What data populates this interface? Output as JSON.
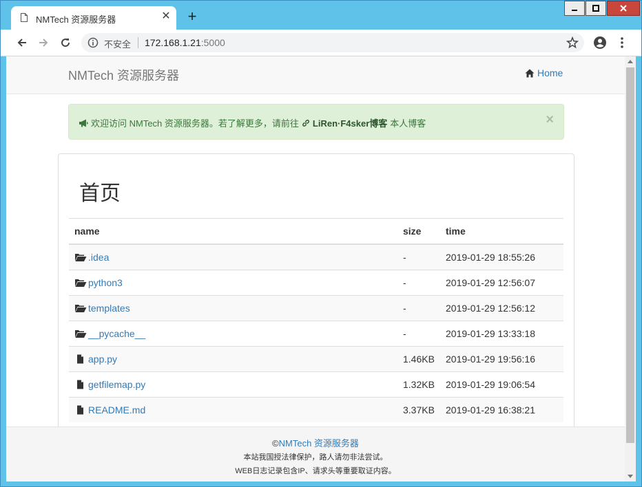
{
  "browser": {
    "tab_title": "NMTech 资源服务器",
    "security_label": "不安全",
    "url_host": "172.168.1.21",
    "url_port": ":5000"
  },
  "navbar": {
    "brand": "NMTech 资源服务器",
    "home_label": "Home"
  },
  "alert": {
    "text_before": "欢迎访问 NMTech 资源服务器。若了解更多，请前往",
    "link_text": "LiRen·F4sker博客",
    "text_after": "本人博客",
    "close": "×"
  },
  "page": {
    "title": "首页"
  },
  "table": {
    "headers": {
      "name": "name",
      "size": "size",
      "time": "time"
    },
    "rows": [
      {
        "icon": "folder-open-icon",
        "name": ".idea",
        "size": "-",
        "time": "2019-01-29 18:55:26"
      },
      {
        "icon": "folder-open-icon",
        "name": "python3",
        "size": "-",
        "time": "2019-01-29 12:56:07"
      },
      {
        "icon": "folder-open-icon",
        "name": "templates",
        "size": "-",
        "time": "2019-01-29 12:56:12"
      },
      {
        "icon": "folder-open-icon",
        "name": "__pycache__",
        "size": "-",
        "time": "2019-01-29 13:33:18"
      },
      {
        "icon": "file-icon",
        "name": "app.py",
        "size": "1.46KB",
        "time": "2019-01-29 19:56:16"
      },
      {
        "icon": "file-icon",
        "name": "getfilemap.py",
        "size": "1.32KB",
        "time": "2019-01-29 19:06:54"
      },
      {
        "icon": "file-icon",
        "name": "README.md",
        "size": "3.37KB",
        "time": "2019-01-29 16:38:21"
      }
    ]
  },
  "footer": {
    "copyright_symbol": "©",
    "brand": "NMTech 资源服务器",
    "line2": "本站我国授法律保护，路人请勿非法尝试。",
    "line3": "WEB日志记录包含IP、请求头等重要取证内容。"
  },
  "colors": {
    "title_bar": "#5ec2e9",
    "link": "#337ab7",
    "alert_bg": "#dff0d8",
    "alert_text": "#3c763d"
  }
}
